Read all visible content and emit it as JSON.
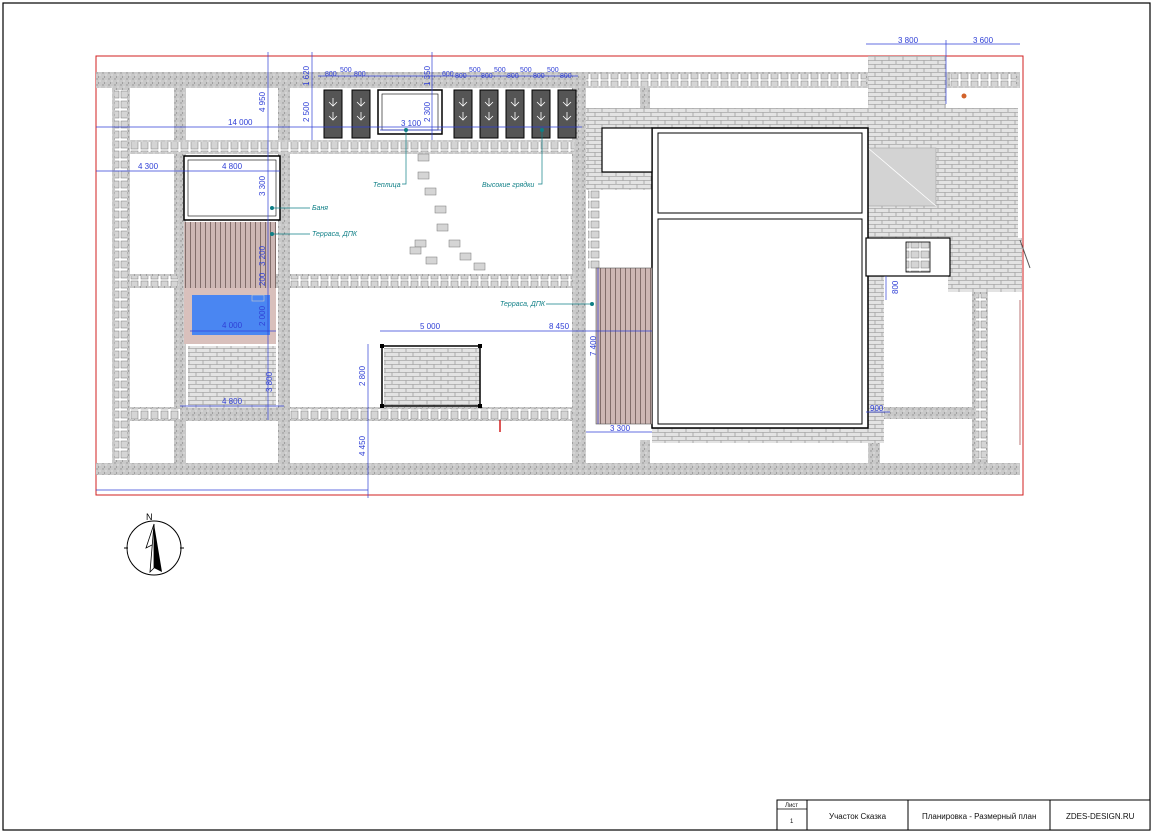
{
  "title_block": {
    "sheet_label": "Лист",
    "sheet_number": "1",
    "project": "Участок Сказка",
    "drawing": "Планировка - Размерный план",
    "company": "ZDES-DESIGN.RU"
  },
  "compass": {
    "north": "N"
  },
  "labels": {
    "greenhouse": "Теплица",
    "raised_beds": "Высокие грядки",
    "bathhouse": "Баня",
    "terrace_left": "Терраса, ДПК",
    "terrace_right": "Терраса, ДПК"
  },
  "dimensions": {
    "d14000": "14 000",
    "d4300": "4 300",
    "d4800_top": "4 800",
    "d4950": "4 950",
    "d2500": "2 500",
    "d1620": "1 620",
    "d3100": "3 100",
    "d2300": "2 300",
    "d1350": "1 350",
    "d3300_bath": "3 300",
    "d3200": "3 200",
    "d200": "200",
    "d2000": "2 000",
    "d4000": "4 000",
    "d3800": "3 800",
    "d4800_bottom": "4 800",
    "d4450": "4 450",
    "d5000": "5 000",
    "d8450": "8 450",
    "d2800": "2 800",
    "d7400": "7 400",
    "d3300_terr": "3 300",
    "d900": "900",
    "d3800_top": "3 800",
    "d3600_top": "3 600",
    "d800_r": "800",
    "bed_500_1": "500",
    "bed_800_1": "800",
    "bed_800_2": "800",
    "bed_600": "600",
    "bed_800_3": "800",
    "bed_500_2": "500",
    "bed_800_4": "800",
    "bed_500_3": "500",
    "bed_800_5": "800",
    "bed_500_4": "500",
    "bed_800_6": "800",
    "bed_500_5": "500",
    "bed_800_7": "800"
  },
  "colors": {
    "dimension": "#2f3fd6",
    "label": "#0f7f86",
    "boundary": "#d21f1f",
    "pool": "#4a86f2",
    "pool_rim": "#d9c0bc",
    "paving": "#d7d7d7"
  }
}
